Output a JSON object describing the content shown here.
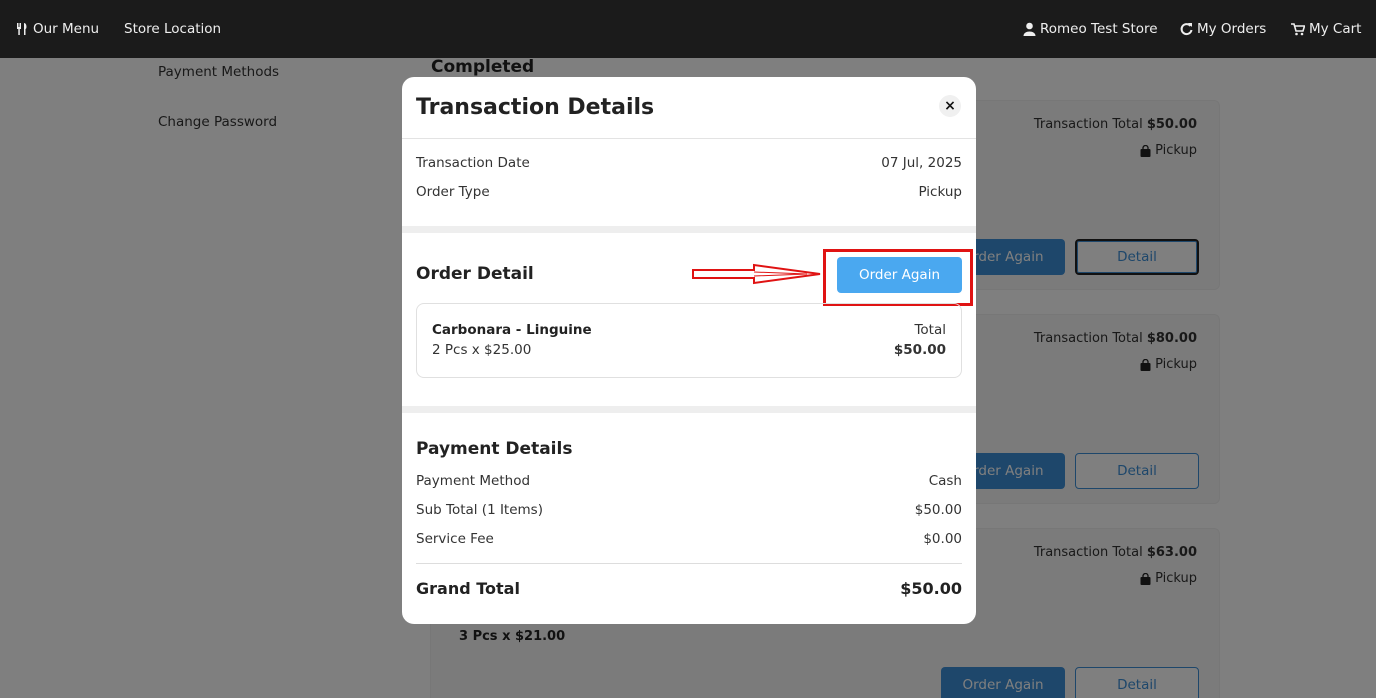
{
  "navbar": {
    "menu_label": "Our Menu",
    "store_location_label": "Store Location",
    "store_name": "Romeo Test Store",
    "my_orders_label": "My Orders",
    "my_cart_label": "My Cart"
  },
  "sidebar": {
    "items": [
      {
        "label": "Payment Methods"
      },
      {
        "label": "Change Password"
      }
    ]
  },
  "orders": {
    "section_title": "Completed",
    "total_label": "Transaction Total",
    "cards": [
      {
        "total": "$50.00",
        "type": "Pickup",
        "reorder_label": "Order Again",
        "detail_label": "Detail"
      },
      {
        "total": "$80.00",
        "type": "Pickup",
        "reorder_label": "Order Again",
        "detail_label": "Detail"
      },
      {
        "total": "$63.00",
        "type": "Pickup",
        "qty": "3 Pcs x $21.00",
        "reorder_label": "Order Again",
        "detail_label": "Detail"
      }
    ]
  },
  "modal": {
    "title": "Transaction Details",
    "close_label": "×",
    "transaction_date_label": "Transaction Date",
    "transaction_date": "07 Jul, 2025",
    "order_type_label": "Order Type",
    "order_type": "Pickup",
    "order_detail_title": "Order Detail",
    "order_again_label": "Order Again",
    "item": {
      "name": "Carbonara - Linguine",
      "qty": "2 Pcs x $25.00",
      "total_label": "Total",
      "total": "$50.00"
    },
    "payment_title": "Payment Details",
    "payment_method_label": "Payment Method",
    "payment_method": "Cash",
    "subtotal_label": "Sub Total (1 Items)",
    "subtotal": "$50.00",
    "service_fee_label": "Service Fee",
    "service_fee": "$0.00",
    "grand_total_label": "Grand Total",
    "grand_total": "$50.00"
  },
  "colors": {
    "navbar_bg": "#1b1b1b",
    "primary_button": "#4aa8f0",
    "annotation_red": "#e01313"
  }
}
